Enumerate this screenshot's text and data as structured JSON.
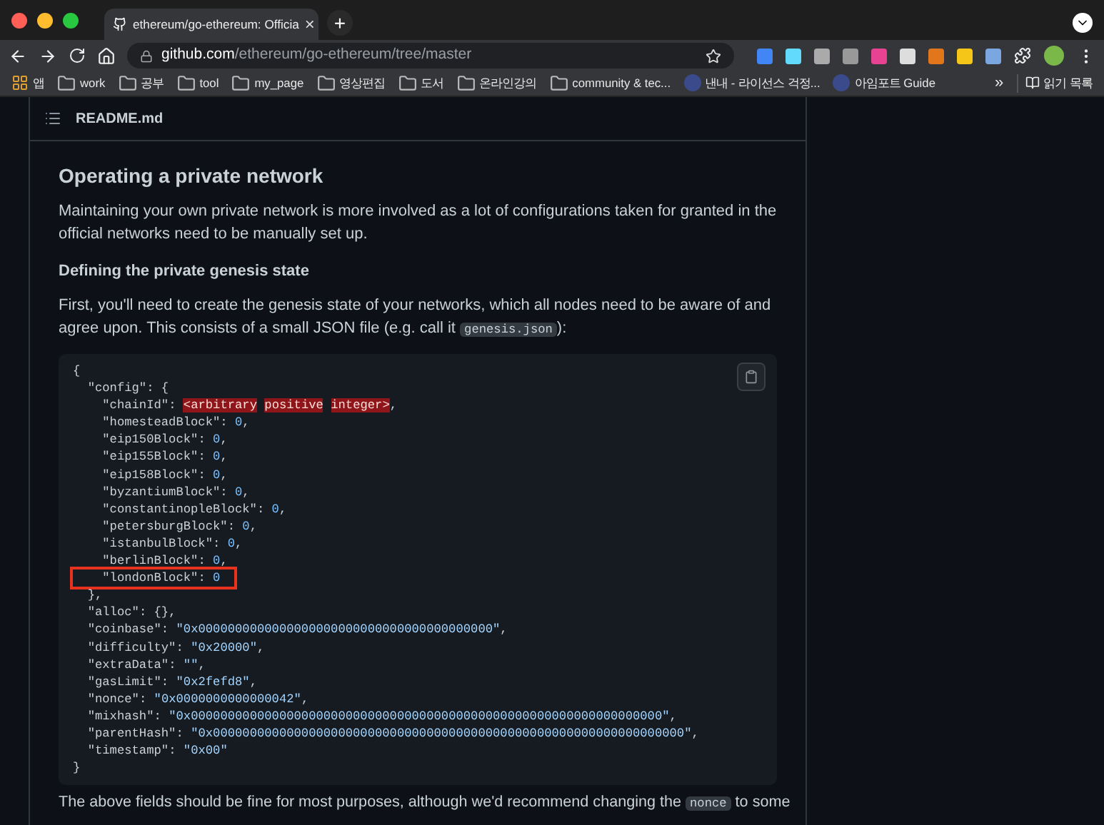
{
  "browser": {
    "tab": {
      "title": "ethereum/go-ethereum: Officia",
      "close": "×"
    },
    "new_tab": "+",
    "address": {
      "host": "github.com",
      "path": "/ethereum/go-ethereum/tree/master"
    },
    "bookmarks": [
      {
        "kind": "apps",
        "label": "앱"
      },
      {
        "kind": "folder",
        "label": "work"
      },
      {
        "kind": "folder",
        "label": "공부"
      },
      {
        "kind": "folder",
        "label": "tool"
      },
      {
        "kind": "folder",
        "label": "my_page"
      },
      {
        "kind": "folder",
        "label": "영상편집"
      },
      {
        "kind": "folder",
        "label": "도서"
      },
      {
        "kind": "folder",
        "label": "온라인강의"
      },
      {
        "kind": "folder",
        "label": "community &  tec..."
      },
      {
        "kind": "site",
        "label": "낸내 - 라이선스 걱정..."
      },
      {
        "kind": "site",
        "label": "아임포트 Guide"
      }
    ],
    "bookmarks_more": "»",
    "reading_list": "읽기 목록"
  },
  "readme": {
    "filename": "README.md",
    "heading": "Operating a private network",
    "intro": "Maintaining your own private network is more involved as a lot of configurations taken for granted in the official networks need to be manually set up.",
    "subheading": "Defining the private genesis state",
    "para_before": "First, you'll need to create the genesis state of your networks, which all nodes need to be aware of and agree upon. This consists of a small JSON file (e.g. call it ",
    "para_code": "genesis.json",
    "para_after": "):",
    "code": [
      {
        "text": "{",
        "boxed": false
      },
      {
        "text": "  \"config\": {",
        "boxed": false
      },
      {
        "text": "    \"chainId\": ",
        "invalid": "<arbitrary positive integer>",
        "tail": ",",
        "boxed": false
      },
      {
        "text": "    \"homesteadBlock\": 0,",
        "boxed": false
      },
      {
        "text": "    \"eip150Block\": 0,",
        "boxed": false
      },
      {
        "text": "    \"eip155Block\": 0,",
        "boxed": false
      },
      {
        "text": "    \"eip158Block\": 0,",
        "boxed": false
      },
      {
        "text": "    \"byzantiumBlock\": 0,",
        "boxed": false
      },
      {
        "text": "    \"constantinopleBlock\": 0,",
        "boxed": false
      },
      {
        "text": "    \"petersburgBlock\": 0,",
        "boxed": false
      },
      {
        "text": "    \"istanbulBlock\": 0,",
        "boxed": false
      },
      {
        "text": "    \"berlinBlock\": 0,",
        "boxed": false
      },
      {
        "text": "    \"londonBlock\": 0",
        "boxed": true
      },
      {
        "text": "  },",
        "boxed": false
      },
      {
        "text": "  \"alloc\": {},",
        "boxed": false
      },
      {
        "text": "  \"coinbase\": \"0x0000000000000000000000000000000000000000\",",
        "boxed": false
      },
      {
        "text": "  \"difficulty\": \"0x20000\",",
        "boxed": false
      },
      {
        "text": "  \"extraData\": \"\",",
        "boxed": false
      },
      {
        "text": "  \"gasLimit\": \"0x2fefd8\",",
        "boxed": false
      },
      {
        "text": "  \"nonce\": \"0x0000000000000042\",",
        "boxed": false
      },
      {
        "text": "  \"mixhash\": \"0x0000000000000000000000000000000000000000000000000000000000000000\",",
        "boxed": false
      },
      {
        "text": "  \"parentHash\": \"0x0000000000000000000000000000000000000000000000000000000000000000\",",
        "boxed": false
      },
      {
        "text": "  \"timestamp\": \"0x00\"",
        "boxed": false
      },
      {
        "text": "}",
        "boxed": false
      }
    ],
    "outro_before": "The above fields should be fine for most purposes, although we'd recommend changing the ",
    "outro_code": "nonce",
    "outro_after": " to some"
  }
}
